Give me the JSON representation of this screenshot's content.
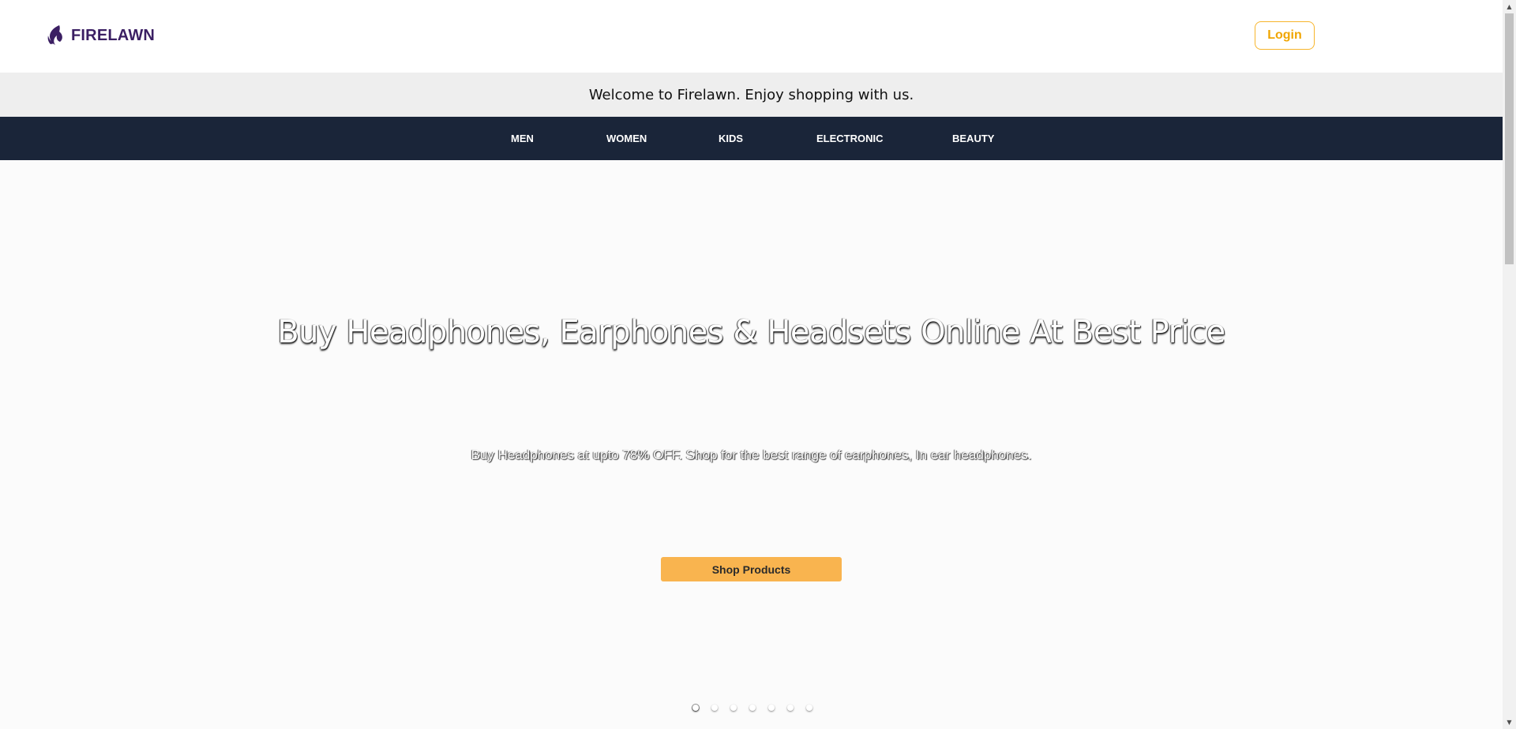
{
  "header": {
    "brand": "FIRELAWN",
    "login_label": "Login"
  },
  "welcome": {
    "message": "Welcome to Firelawn. Enjoy shopping with us."
  },
  "nav": {
    "items": [
      {
        "label": "MEN"
      },
      {
        "label": "WOMEN"
      },
      {
        "label": "KIDS"
      },
      {
        "label": "ELECTRONIC"
      },
      {
        "label": "BEAUTY"
      }
    ]
  },
  "hero": {
    "title": "Buy Headphones, Earphones & Headsets Online At Best Price",
    "subtitle": "Buy Headphones at upto 78% OFF. Shop for the best range of earphones, In ear headphones.",
    "cta_label": "Shop Products",
    "slides_total": 7,
    "active_slide": 1
  },
  "colors": {
    "brand": "#3b1f63",
    "accent": "#f7b52c",
    "nav_bg": "#1a2539",
    "welcome_bg": "#eeeeee",
    "cta_bg": "#f9b44f"
  },
  "icons": {
    "logo": "flame-logo-icon",
    "scroll_up": "scroll-up-arrow-icon",
    "scroll_down": "scroll-down-arrow-icon"
  }
}
